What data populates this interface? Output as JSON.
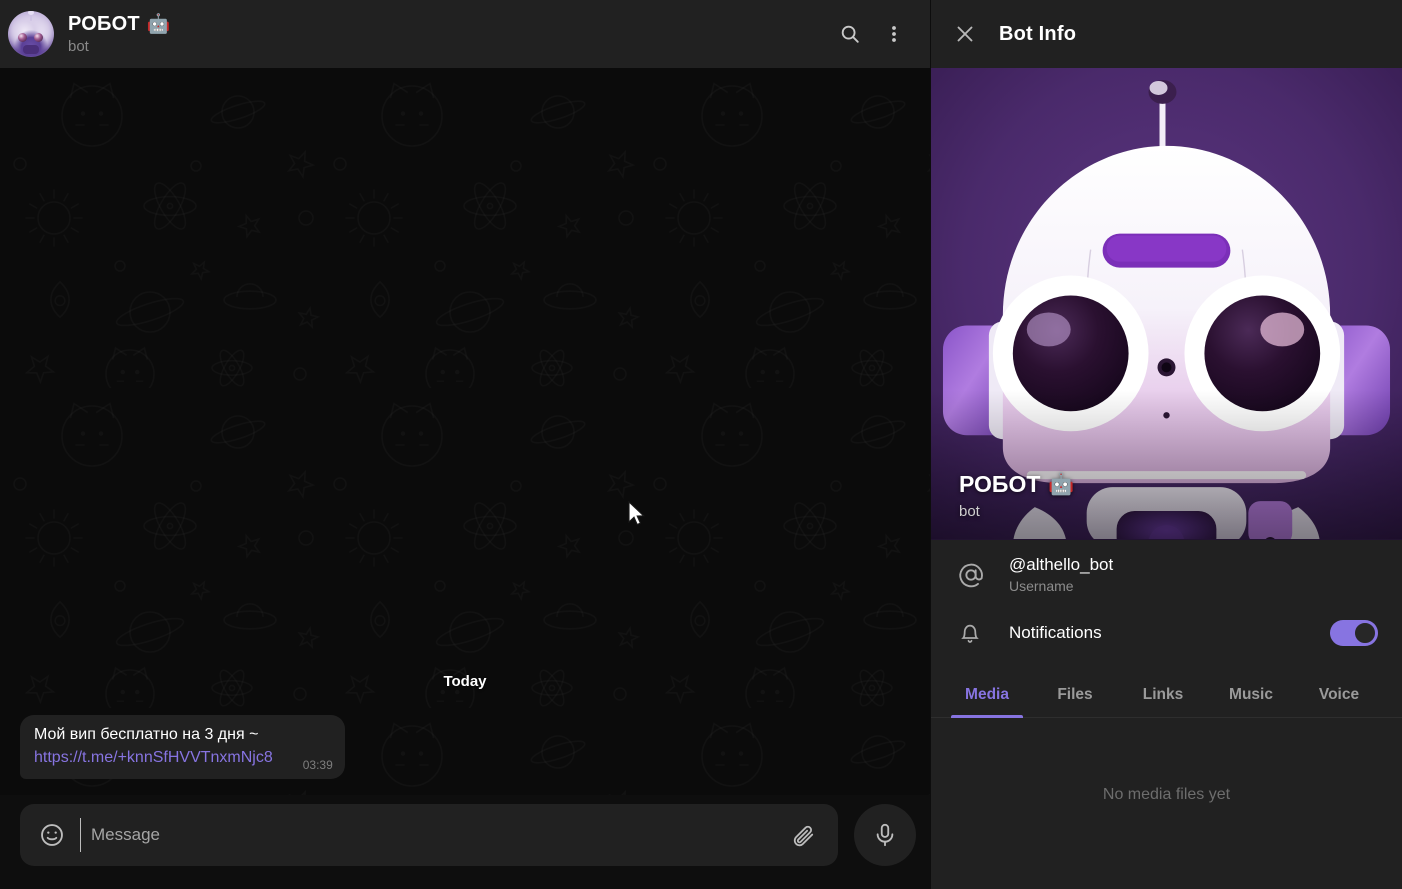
{
  "colors": {
    "accent": "#8774e1",
    "panel_bg": "#212121",
    "chat_bg": "#0b0b0b",
    "text_primary": "#ffffff",
    "text_secondary": "#8a8a8a"
  },
  "chat_header": {
    "title": "РОБОТ",
    "title_emoji": "🤖",
    "subtitle": "bot",
    "search_icon": "search-icon",
    "menu_icon": "more-vertical-icon",
    "avatar_icon": "avatar"
  },
  "chat": {
    "date_separator": "Today",
    "messages": [
      {
        "text": "Мой вип бесплатно на 3 дня ~",
        "link": "https://t.me/+knnSfHVVTnxmNjc8",
        "time": "03:39",
        "outgoing": false
      }
    ]
  },
  "composer": {
    "placeholder": "Message",
    "value": "",
    "emoji_icon": "smiley-icon",
    "attach_icon": "paperclip-icon",
    "mic_icon": "microphone-icon"
  },
  "info_panel": {
    "title": "Bot Info",
    "close_icon": "close-icon",
    "hero": {
      "name": "РОБОТ",
      "name_emoji": "🤖",
      "subtitle": "bot"
    },
    "rows": [
      {
        "icon": "at-sign-icon",
        "main": "@althello_bot",
        "sub": "Username",
        "type": "text"
      },
      {
        "icon": "bell-icon",
        "main": "Notifications",
        "sub": "",
        "type": "toggle",
        "toggle_on": true
      }
    ],
    "tabs": [
      {
        "label": "Media",
        "active": true
      },
      {
        "label": "Files",
        "active": false
      },
      {
        "label": "Links",
        "active": false
      },
      {
        "label": "Music",
        "active": false
      },
      {
        "label": "Voice",
        "active": false
      }
    ],
    "empty_state": "No media files yet"
  }
}
